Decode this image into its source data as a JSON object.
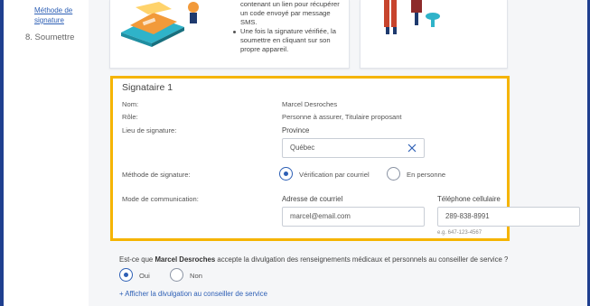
{
  "sidebar": {
    "link_line1": "Méthode de",
    "link_line2": "signature",
    "step8": "8. Soumettre"
  },
  "card1": {
    "text_line1": "contenant un lien pour récupérer",
    "text_line2": "un code envoyé par message",
    "text_line3": "SMS.",
    "bullet_line1": "Une fois la signature vérifiée, la",
    "bullet_line2": "soumettre en cliquant sur son",
    "bullet_line3": "propre appareil."
  },
  "signer": {
    "title": "Signataire 1",
    "name_label": "Nom:",
    "name_value": "Marcel Desroches",
    "role_label": "Rôle:",
    "role_value": "Personne à assurer, Titulaire proposant",
    "place_label": "Lieu de signature:",
    "province_label": "Province",
    "province_value": "Québec",
    "method_label": "Méthode de signature:",
    "method_option1": "Vérification par courriel",
    "method_option2": "En personne",
    "comm_label": "Mode de communication:",
    "email_label": "Adresse de courriel",
    "email_value": "marcel@email.com",
    "phone_label": "Téléphone cellulaire",
    "phone_value": "289-838-8991",
    "phone_hint": "e.g. 647-123-4567"
  },
  "disclosure": {
    "question_prefix": "Est-ce que ",
    "question_name": "Marcel Desroches",
    "question_suffix": " accepte la divulgation des renseignements médicaux et personnels au conseiller de service ?",
    "yes": "Oui",
    "no": "Non",
    "show_link": "+ Afficher la divulgation au conseiller de service"
  },
  "colors": {
    "accent": "#2d5fb5",
    "highlight": "#f5b400",
    "frame": "#1f3f8f"
  }
}
